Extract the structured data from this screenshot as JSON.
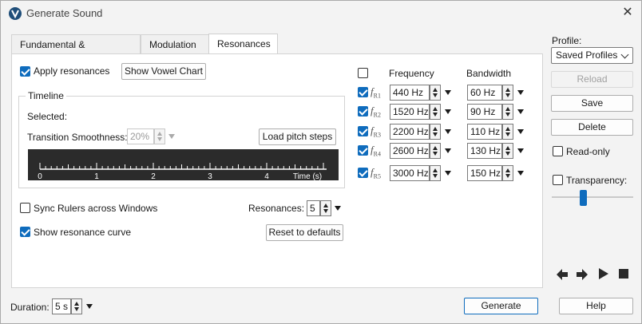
{
  "window": {
    "title": "Generate Sound"
  },
  "tabs": [
    {
      "label": "Fundamental & Overtones",
      "active": false
    },
    {
      "label": "Modulation",
      "active": false
    },
    {
      "label": "Resonances",
      "active": true
    }
  ],
  "resonances_tab": {
    "apply_label": "Apply resonances",
    "apply_checked": true,
    "show_vowel_chart": "Show Vowel Chart",
    "timeline": {
      "title": "Timeline",
      "selected_label": "Selected:",
      "transition_label": "Transition Smoothness:",
      "transition_value": "20%",
      "load_pitch_steps": "Load pitch steps",
      "ruler_ticks": [
        "0",
        "1",
        "2",
        "3",
        "4"
      ],
      "ruler_unit": "Time (s)"
    },
    "sync_rulers_label": "Sync Rulers across Windows",
    "sync_rulers_checked": false,
    "show_curve_label": "Show resonance curve",
    "show_curve_checked": true,
    "resonances_count_label": "Resonances:",
    "resonances_count_value": "5",
    "reset_defaults": "Reset to defaults",
    "table": {
      "header_frequency": "Frequency",
      "header_bandwidth": "Bandwidth",
      "rows": [
        {
          "sym": "f",
          "sub": "R1",
          "checked": true,
          "frequency": "440 Hz",
          "bandwidth": "60 Hz"
        },
        {
          "sym": "f",
          "sub": "R2",
          "checked": true,
          "frequency": "1520 Hz",
          "bandwidth": "90 Hz"
        },
        {
          "sym": "f",
          "sub": "R3",
          "checked": true,
          "frequency": "2200 Hz",
          "bandwidth": "110 Hz"
        },
        {
          "sym": "f",
          "sub": "R4",
          "checked": true,
          "frequency": "2600 Hz",
          "bandwidth": "130 Hz"
        },
        {
          "sym": "f",
          "sub": "R5",
          "checked": true,
          "frequency": "3000 Hz",
          "bandwidth": "150 Hz"
        }
      ]
    }
  },
  "sidebar": {
    "profile_label": "Profile:",
    "profile_value": "Saved Profiles",
    "reload": "Reload",
    "save": "Save",
    "delete": "Delete",
    "read_only_label": "Read-only",
    "transparency_label": "Transparency:",
    "transparency_level_fraction": 0.38
  },
  "footer": {
    "duration_label": "Duration:",
    "duration_value": "5 s",
    "generate": "Generate",
    "help": "Help"
  },
  "colors": {
    "accent": "#0f6cbd",
    "timeline_bg": "#2b2b2b"
  },
  "icons": [
    "app-logo-icon",
    "close-icon",
    "arrow-left-icon",
    "arrow-right-icon",
    "play-icon",
    "stop-icon"
  ]
}
